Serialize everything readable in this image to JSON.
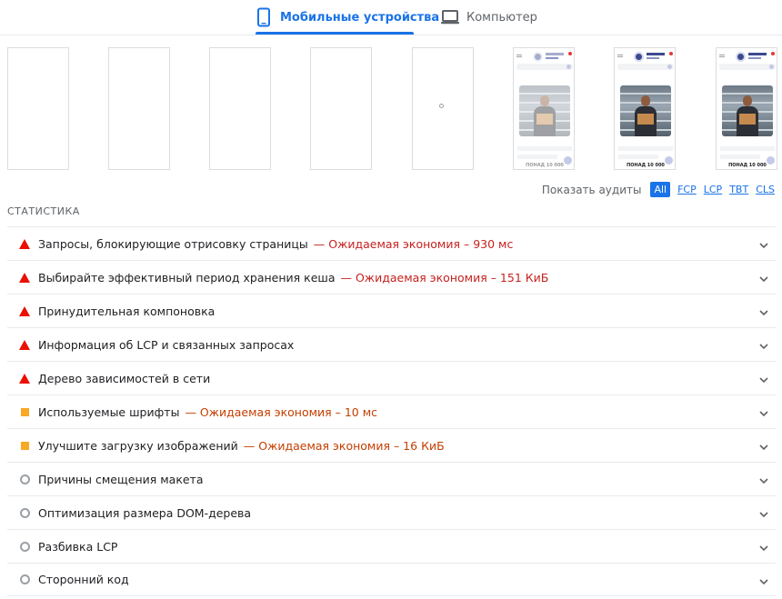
{
  "tabs": {
    "mobile_label": "Мобильные устройства",
    "desktop_label": "Компьютер",
    "accent_color": "#1a73e8"
  },
  "filmstrip": {
    "frames": [
      {
        "state": "blank"
      },
      {
        "state": "blank"
      },
      {
        "state": "blank"
      },
      {
        "state": "blank"
      },
      {
        "state": "loading"
      },
      {
        "state": "content",
        "price": "ПОНАД 10 000",
        "faded": true
      },
      {
        "state": "content",
        "price": "ПОНАД 10 000",
        "faded": false
      },
      {
        "state": "content",
        "price": "ПОНАД 10 000",
        "faded": false
      }
    ]
  },
  "show_audits": {
    "label": "Показать аудиты",
    "filters": [
      {
        "label": "All",
        "active": true
      },
      {
        "label": "FCP",
        "active": false
      },
      {
        "label": "LCP",
        "active": false
      },
      {
        "label": "TBT",
        "active": false
      },
      {
        "label": "CLS",
        "active": false
      }
    ]
  },
  "section_title": "СТАТИСТИКА",
  "audits": [
    {
      "indicator": "fail",
      "icon": "red-triangle-icon",
      "title": "Запросы, блокирующие отрисовку страницы",
      "savings": "— Ожидаемая экономия – 930 мс"
    },
    {
      "indicator": "fail",
      "icon": "red-triangle-icon",
      "title": "Выбирайте эффективный период хранения кеша",
      "savings": "— Ожидаемая экономия – 151 КиБ"
    },
    {
      "indicator": "fail",
      "icon": "red-triangle-icon",
      "title": "Принудительная компоновка",
      "savings": ""
    },
    {
      "indicator": "fail",
      "icon": "red-triangle-icon",
      "title": "Информация об LCP и связанных запросах",
      "savings": ""
    },
    {
      "indicator": "fail",
      "icon": "red-triangle-icon",
      "title": "Дерево зависимостей в сети",
      "savings": ""
    },
    {
      "indicator": "average",
      "icon": "orange-square-icon",
      "title": "Используемые шрифты",
      "savings": "— Ожидаемая экономия – 10 мс"
    },
    {
      "indicator": "average",
      "icon": "orange-square-icon",
      "title": "Улучшите загрузку изображений",
      "savings": "— Ожидаемая экономия – 16 КиБ"
    },
    {
      "indicator": "info",
      "icon": "gray-circle-icon",
      "title": "Причины смещения макета",
      "savings": ""
    },
    {
      "indicator": "info",
      "icon": "gray-circle-icon",
      "title": "Оптимизация размера DOM-дерева",
      "savings": ""
    },
    {
      "indicator": "info",
      "icon": "gray-circle-icon",
      "title": "Разбивка LCP",
      "savings": ""
    },
    {
      "indicator": "info",
      "icon": "gray-circle-icon",
      "title": "Сторонний код",
      "savings": ""
    }
  ],
  "colors": {
    "fail": "#eb0f00",
    "average": "#f9a825",
    "info": "#9aa0a6",
    "savings_fail": "#c5221f",
    "savings_average": "#c43e00"
  }
}
